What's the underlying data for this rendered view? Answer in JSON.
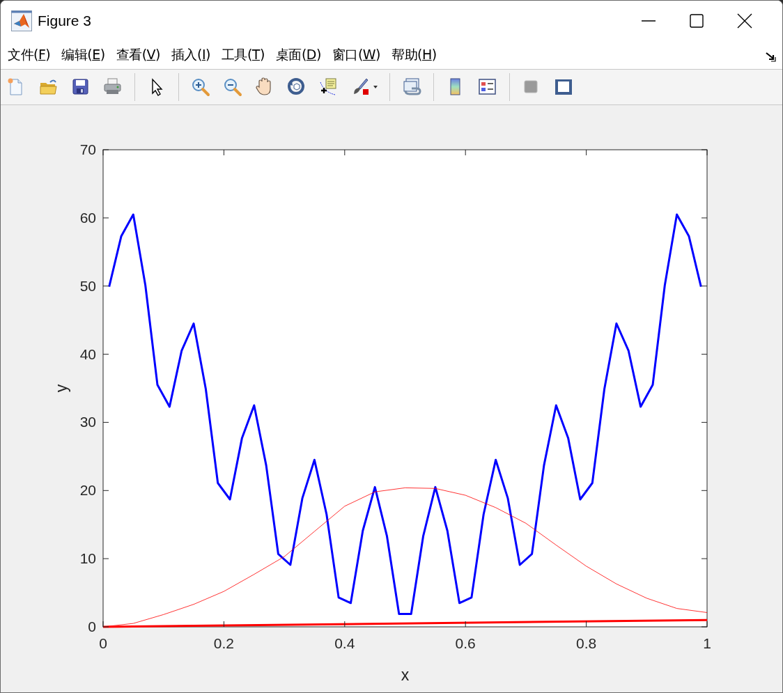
{
  "window": {
    "title": "Figure 3"
  },
  "menu": [
    {
      "before": "文件(",
      "key": "F",
      "after": ")"
    },
    {
      "before": "编辑(",
      "key": "E",
      "after": ")"
    },
    {
      "before": "查看(",
      "key": "V",
      "after": ")"
    },
    {
      "before": "插入(",
      "key": "I",
      "after": ")"
    },
    {
      "before": "工具(",
      "key": "T",
      "after": ")"
    },
    {
      "before": "桌面(",
      "key": "D",
      "after": ")"
    },
    {
      "before": "窗口(",
      "key": "W",
      "after": ")"
    },
    {
      "before": "帮助(",
      "key": "H",
      "after": ")"
    }
  ],
  "figure": {
    "chart_data": {
      "type": "line",
      "xlabel": "x",
      "ylabel": "y",
      "xlim": [
        0,
        1
      ],
      "ylim": [
        0,
        70
      ],
      "xticks": [
        0,
        0.2,
        0.4,
        0.6,
        0.8,
        1
      ],
      "yticks": [
        0,
        10,
        20,
        30,
        40,
        50,
        60,
        70
      ],
      "series": [
        {
          "color": "#0000ff",
          "x": [
            0.01,
            0.03,
            0.05,
            0.07,
            0.09,
            0.11,
            0.13,
            0.15,
            0.17,
            0.19,
            0.21,
            0.23,
            0.25,
            0.27,
            0.29,
            0.31,
            0.33,
            0.35,
            0.37,
            0.39,
            0.41,
            0.43,
            0.45,
            0.47,
            0.49,
            0.51,
            0.53,
            0.55,
            0.57,
            0.59,
            0.61,
            0.63,
            0.65,
            0.67,
            0.69,
            0.71,
            0.73,
            0.75,
            0.77,
            0.79,
            0.81,
            0.83,
            0.85,
            0.87,
            0.89,
            0.91,
            0.93,
            0.95,
            0.97,
            0.99
          ],
          "values": [
            49.9,
            57.3,
            60.5,
            50.1,
            35.5,
            32.3,
            40.5,
            44.5,
            34.9,
            21.1,
            18.7,
            27.7,
            32.5,
            23.7,
            10.7,
            9.1,
            18.9,
            24.5,
            16.5,
            4.3,
            3.5,
            14.1,
            20.5,
            13.3,
            1.9,
            1.9,
            13.3,
            20.5,
            14.1,
            3.5,
            4.3,
            16.5,
            24.5,
            18.9,
            9.1,
            10.7,
            23.7,
            32.5,
            27.7,
            18.7,
            21.1,
            34.9,
            44.5,
            40.5,
            32.3,
            35.5,
            50.1,
            60.5,
            57.3,
            49.9
          ]
        },
        {
          "color": "#ff0000",
          "x": [
            0,
            0.05,
            0.1,
            0.15,
            0.2,
            0.25,
            0.3,
            0.35,
            0.4,
            0.45,
            0.5,
            0.55,
            0.6,
            0.65,
            0.7,
            0.75,
            0.8,
            0.85,
            0.9,
            0.95,
            1
          ],
          "values": [
            0,
            0.5,
            1.8,
            3.3,
            5.2,
            7.7,
            10.3,
            14,
            17.7,
            19.8,
            20.4,
            20.3,
            19.3,
            17.5,
            15.2,
            12,
            8.9,
            6.3,
            4.2,
            2.7,
            2.1
          ]
        },
        {
          "color": "#ff0000",
          "x": [
            0,
            1
          ],
          "values": [
            0,
            1
          ]
        }
      ]
    }
  }
}
